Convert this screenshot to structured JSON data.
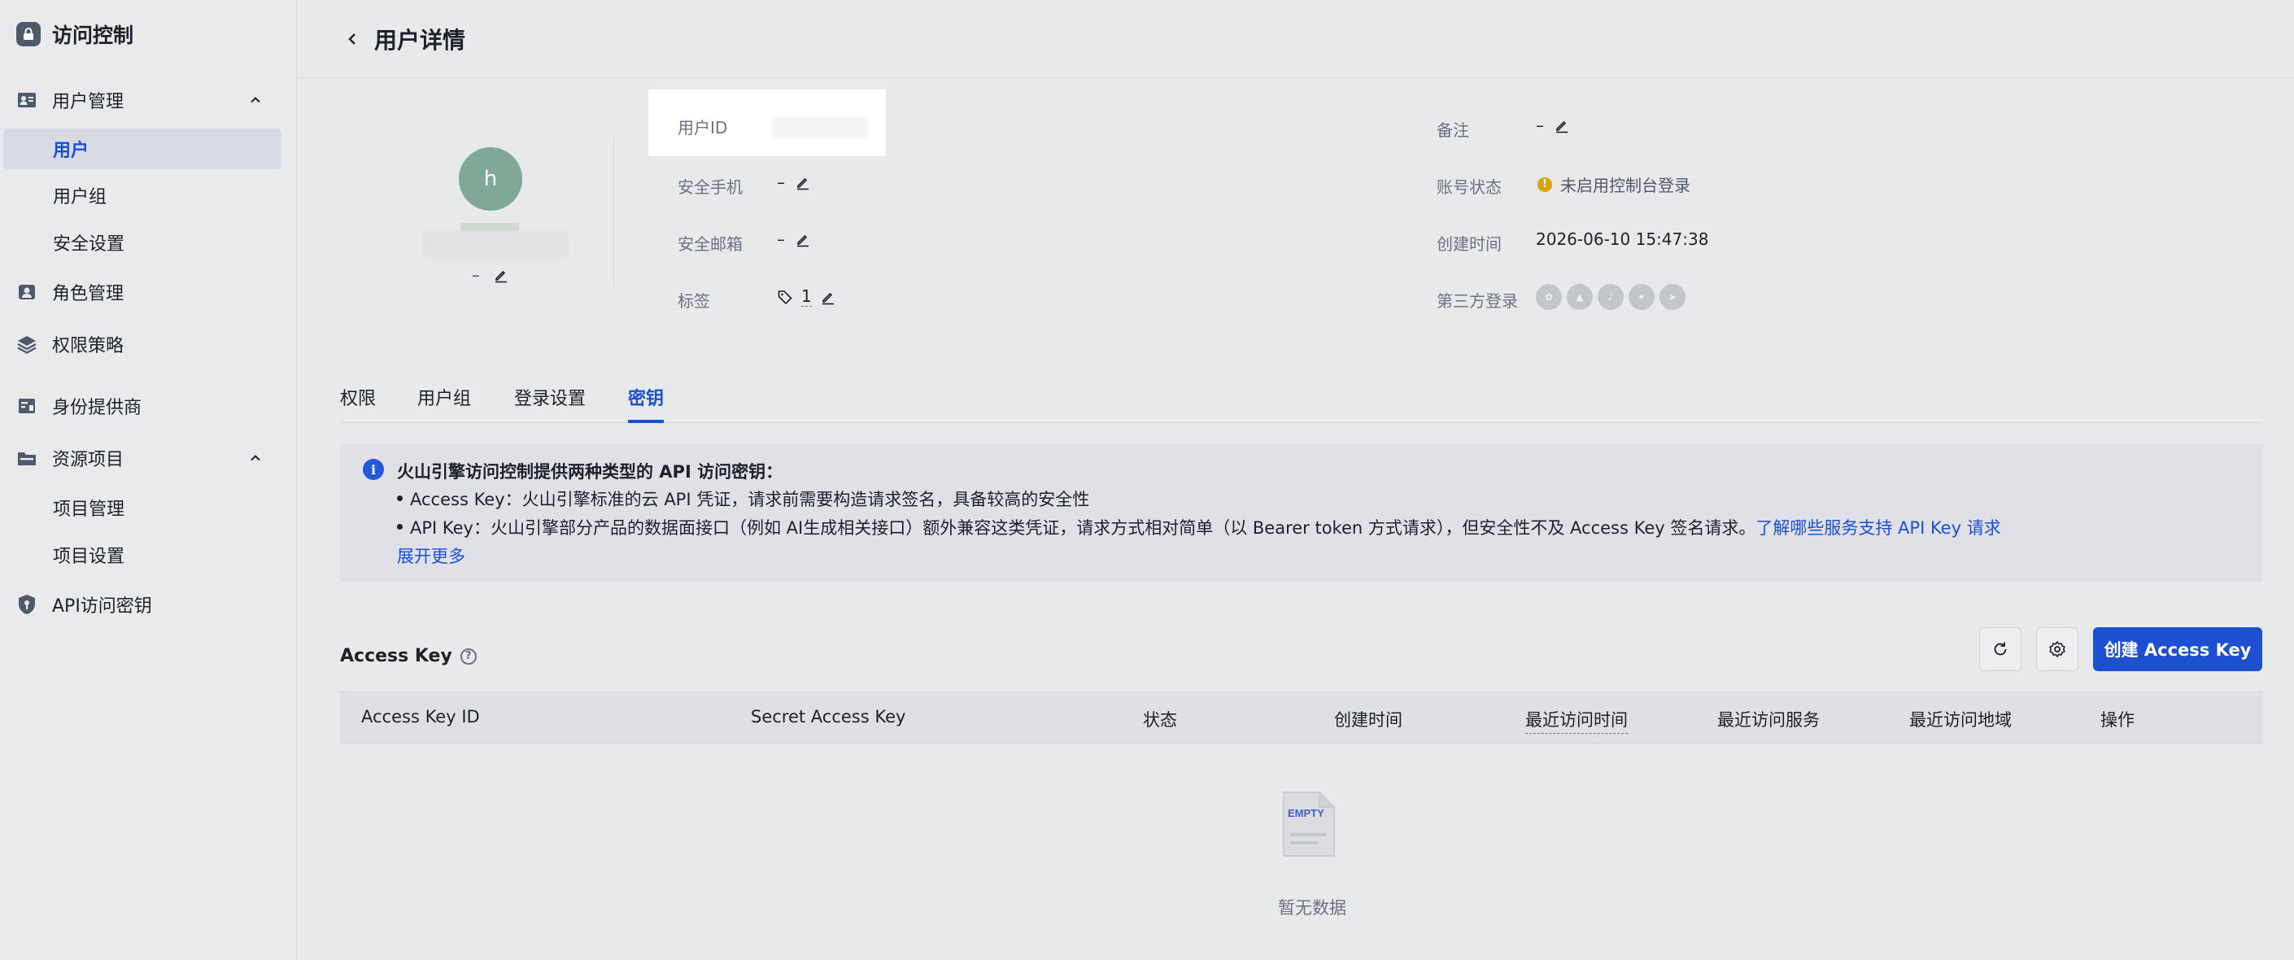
{
  "sidebar": {
    "brand": "访问控制",
    "items": {
      "user_mgmt": "用户管理",
      "users": "用户",
      "user_groups": "用户组",
      "security_settings": "安全设置",
      "role_mgmt": "角色管理",
      "policies": "权限策略",
      "idp": "身份提供商",
      "resource_projects": "资源项目",
      "project_mgmt": "项目管理",
      "project_settings": "项目设置",
      "api_keys": "API访问密钥"
    }
  },
  "header": {
    "title": "用户详情"
  },
  "profile": {
    "avatar_letter": "h",
    "note_value": "–"
  },
  "fields": {
    "user_id_label": "用户ID",
    "phone_label": "安全手机",
    "phone_value": "–",
    "email_label": "安全邮箱",
    "email_value": "–",
    "tags_label": "标签",
    "tags_count": "1",
    "remark_label": "备注",
    "remark_value": "–",
    "status_label": "账号状态",
    "status_value": "未启用控制台登录",
    "created_label": "创建时间",
    "created_value": "2026-06-10 15:47:38",
    "third_party_label": "第三方登录"
  },
  "tabs": [
    "权限",
    "用户组",
    "登录设置",
    "密钥"
  ],
  "active_tab": "密钥",
  "banner": {
    "title": "火山引擎访问控制提供两种类型的 API 访问密钥：",
    "line1": "Access Key：火山引擎标准的云 API 凭证，请求前需要构造请求签名，具备较高的安全性",
    "line2": "API Key：火山引擎部分产品的数据面接口（例如 AI生成相关接口）额外兼容这类凭证，请求方式相对简单（以 Bearer token 方式请求），但安全性不及 Access Key 签名请求。",
    "line2_link": "了解哪些服务支持 API Key 请求",
    "expand": "展开更多"
  },
  "access_key": {
    "title": "Access Key",
    "create_button": "创建 Access Key",
    "columns": [
      "Access Key ID",
      "Secret Access Key",
      "状态",
      "创建时间",
      "最近访问时间",
      "最近访问服务",
      "最近访问地域",
      "操作"
    ],
    "empty_text": "暂无数据",
    "empty_badge": "EMPTY"
  },
  "colors": {
    "accent": "#1d4fd0",
    "status_warning": "#d9a600",
    "avatar": "#7fa896"
  }
}
